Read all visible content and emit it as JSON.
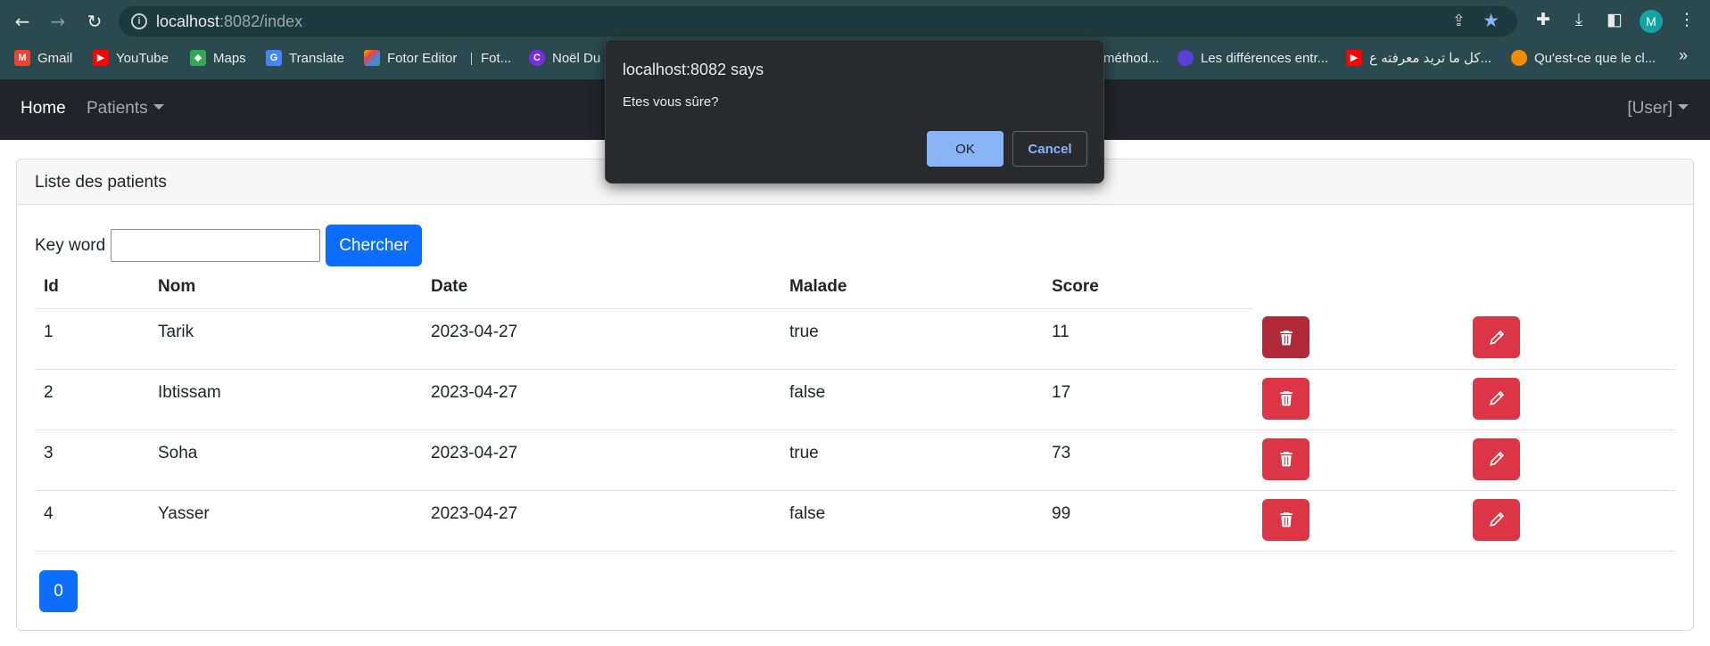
{
  "browser": {
    "url_host": "localhost",
    "url_rest": ":8082/index",
    "avatar_letter": "M",
    "bookmarks": [
      {
        "label": "Gmail",
        "icon": "gmail-icon",
        "color": "#ea4335"
      },
      {
        "label": "YouTube",
        "icon": "youtube-icon",
        "color": "#ff0000"
      },
      {
        "label": "Maps",
        "icon": "maps-icon",
        "color": "#34a853"
      },
      {
        "label": "Translate",
        "icon": "translate-icon",
        "color": "#4285f4"
      },
      {
        "label": "Fotor Editor",
        "icon": "fotor-icon",
        "color": "#f4b400"
      },
      {
        "label": "Fot...",
        "icon": "fotor-icon",
        "color": "#f4b400"
      },
      {
        "label": "Noël Du",
        "icon": "canva-icon",
        "color": "#7d2ae8"
      },
      {
        "label": "méthod...",
        "icon": "bookmark-icon",
        "color": "#4285f4"
      },
      {
        "label": "Les différences entr...",
        "icon": "site-icon",
        "color": "#5b3fd6"
      },
      {
        "label": "كل ما تريد معرفته ع...",
        "icon": "youtube-icon",
        "color": "#ff0000"
      },
      {
        "label": "Qu'est-ce que le cl...",
        "icon": "site-icon",
        "color": "#f28b00"
      }
    ],
    "more_label": "»"
  },
  "navbar": {
    "brand": "Home",
    "patients_menu": "Patients",
    "user_menu": "[User]"
  },
  "card": {
    "header": "Liste des patients",
    "search_label": "Key word",
    "search_value": "",
    "search_button": "Chercher",
    "columns": [
      "Id",
      "Nom",
      "Date",
      "Malade",
      "Score"
    ],
    "rows": [
      {
        "id": "1",
        "nom": "Tarik",
        "date": "2023-04-27",
        "malade": "true",
        "score": "11"
      },
      {
        "id": "2",
        "nom": "Ibtissam",
        "date": "2023-04-27",
        "malade": "false",
        "score": "17"
      },
      {
        "id": "3",
        "nom": "Soha",
        "date": "2023-04-27",
        "malade": "true",
        "score": "73"
      },
      {
        "id": "4",
        "nom": "Yasser",
        "date": "2023-04-27",
        "malade": "false",
        "score": "99"
      }
    ],
    "page_label": "0"
  },
  "dialog": {
    "title": "localhost:8082 says",
    "message": "Etes vous sûre?",
    "ok": "OK",
    "cancel": "Cancel"
  },
  "colors": {
    "primary": "#0d6efd",
    "danger": "#dc3545",
    "navbar": "#212529",
    "chrome": "#2b4a4f"
  }
}
